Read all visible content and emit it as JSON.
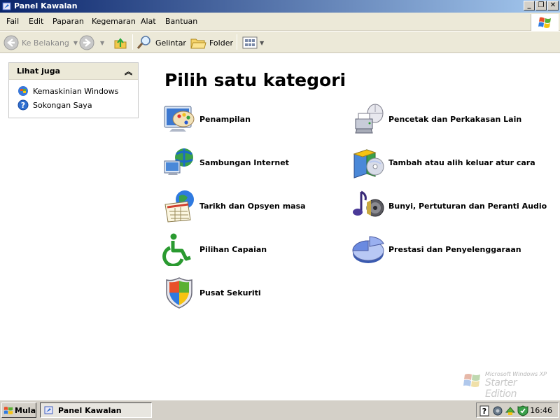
{
  "window": {
    "title": "Panel Kawalan",
    "minimize": "_",
    "maximize": "❐",
    "close": "✕"
  },
  "menu": {
    "items": [
      "Fail",
      "Edit",
      "Paparan",
      "Kegemaran",
      "Alat",
      "Bantuan"
    ]
  },
  "toolbar": {
    "back_label": "Ke Belakang",
    "search_label": "Gelintar",
    "folders_label": "Folder"
  },
  "sidebar": {
    "title": "Lihat juga",
    "links": [
      {
        "label": "Kemaskinian Windows",
        "icon": "windows-update-icon"
      },
      {
        "label": "Sokongan Saya",
        "icon": "help-support-icon"
      }
    ]
  },
  "main": {
    "heading": "Pilih satu kategori",
    "categories_left": [
      {
        "label": "Penampilan",
        "icon": "appearance-icon"
      },
      {
        "label": "Sambungan Internet",
        "icon": "network-internet-icon"
      },
      {
        "label": "Tarikh dan Opsyen masa",
        "icon": "date-time-icon"
      },
      {
        "label": "Pilihan Capaian",
        "icon": "accessibility-icon"
      },
      {
        "label": "Pusat Sekuriti",
        "icon": "security-shield-icon"
      }
    ],
    "categories_right": [
      {
        "label": "Pencetak dan Perkakasan Lain",
        "icon": "printer-hardware-icon"
      },
      {
        "label": "Tambah atau alih keluar atur cara",
        "icon": "add-remove-programs-icon"
      },
      {
        "label": "Bunyi, Pertuturan dan Peranti Audio",
        "icon": "sound-audio-icon"
      },
      {
        "label": "Prestasi dan Penyelenggaraan",
        "icon": "performance-pie-icon"
      }
    ]
  },
  "watermark": {
    "line1": "Microsoft Windows XP",
    "line2": "Starter Edition"
  },
  "taskbar": {
    "start_label": "Mula",
    "task_label": "Panel Kawalan",
    "clock": "16:46"
  }
}
